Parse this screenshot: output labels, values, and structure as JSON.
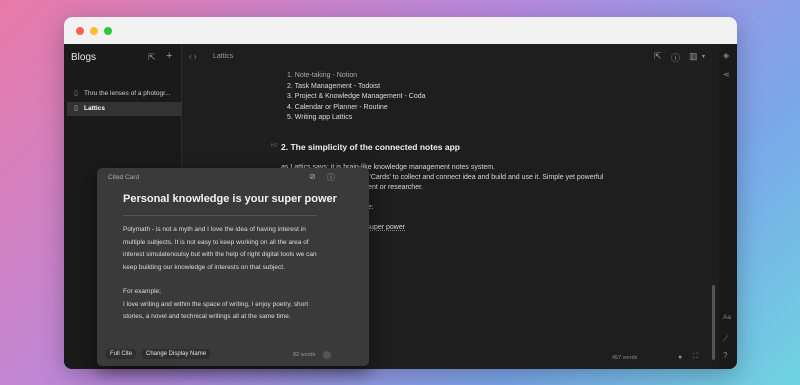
{
  "sidebar": {
    "title": "Blogs",
    "items": [
      {
        "label": "Thru the lenses of a photogr..."
      },
      {
        "label": "Lattics"
      }
    ]
  },
  "topbar": {
    "breadcrumb": "Lattics"
  },
  "document": {
    "list_items": [
      "1. Note-taking - Notion",
      "2. Task Management - Todoist",
      "3. Project & Knowledge Management - Coda",
      "4. Calendar or Planner - Routine",
      "5. Writing app Lattics"
    ],
    "heading_marker": "H2",
    "heading": "2. The simplicity of the connected notes app",
    "para1": "as Lattics says; it is brain-like knowledge management notes system.",
    "para2": "you can use it's core idea of 'Cards' to collect and connect idea and build and use it. Simple yet powerful",
    "para3_fragment": ", student or researcher.",
    "para4_fragment": "example:",
    "para5_fragment": "is your super power"
  },
  "status": {
    "word_count": "457 words"
  },
  "cited_card": {
    "label": "Cited Card",
    "title": "Personal knowledge is your super power",
    "body": [
      "Polymath - is not a myth and I love the idea of having interest in multiple subjects. It is not easy to keep working on all the area of interest simulatenoulsy but with the help of right digital tools we can keep building our knowledge of interests on that subject.",
      "For example;",
      "I love writing and within the space of writing, I enjoy poetry, short stories, a novel and technical writings all at the same time."
    ],
    "full_cite_label": "Full Cite",
    "change_name_label": "Change Display Name",
    "word_count": "82 words"
  }
}
